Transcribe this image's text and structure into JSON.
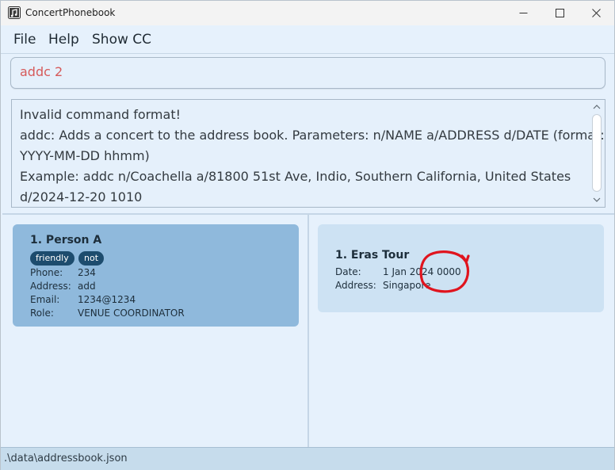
{
  "window": {
    "title": "ConcertPhonebook"
  },
  "menu": {
    "items": [
      "File",
      "Help",
      "Show CC"
    ]
  },
  "command": {
    "value": "addc 2"
  },
  "result": {
    "lines": [
      "Invalid command format!",
      "addc: Adds a concert to the address book. Parameters: n/NAME a/ADDRESS d/DATE (format:",
      "YYYY-MM-DD hhmm)",
      "Example: addc n/Coachella a/81800 51st Ave, Indio, Southern California, United States",
      "d/2024-12-20 1010"
    ]
  },
  "persons": [
    {
      "name": "1. Person A",
      "tags": [
        "friendly",
        "not"
      ],
      "fields": [
        {
          "label": "Phone:",
          "value": "234"
        },
        {
          "label": "Address:",
          "value": "add"
        },
        {
          "label": "Email:",
          "value": "1234@1234"
        },
        {
          "label": "Role:",
          "value": "VENUE COORDINATOR"
        }
      ]
    }
  ],
  "concerts": [
    {
      "name": "1. Eras Tour",
      "fields": [
        {
          "label": "Date:",
          "value": "1 Jan 2024 0000"
        },
        {
          "label": "Address:",
          "value": "Singapore"
        }
      ]
    }
  ],
  "status": {
    "path": ".\\data\\addressbook.json"
  },
  "colors": {
    "accent": "#1d4c6e",
    "selected_card": "#8fb9dc",
    "concert_card": "#cde2f3",
    "annotation": "#e0141e",
    "error_text": "#d65a5a"
  }
}
